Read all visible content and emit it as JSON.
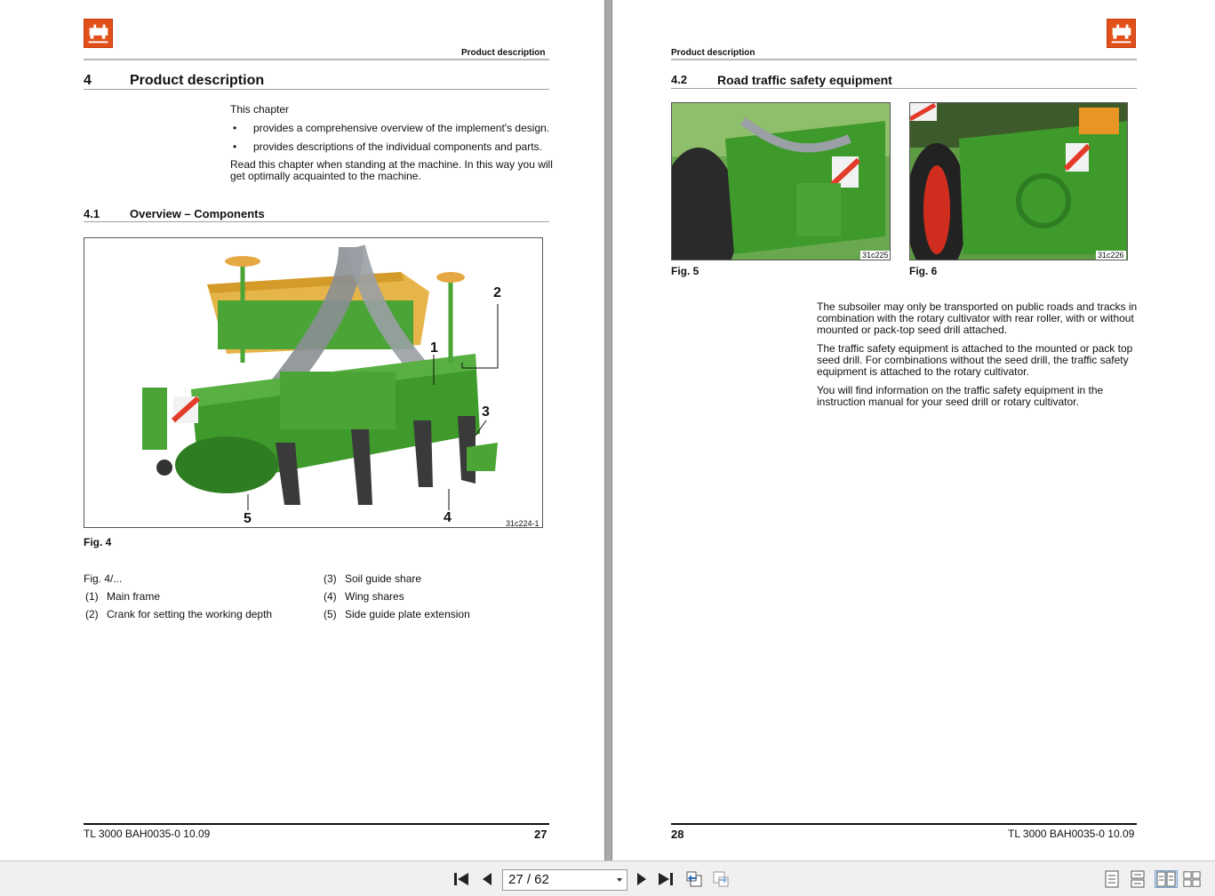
{
  "left_page": {
    "running_header": "Product description",
    "chapter": {
      "number": "4",
      "title": "Product description"
    },
    "intro": "This chapter",
    "bullets": [
      "provides a comprehensive overview of the implement's design.",
      "provides descriptions of the individual components and parts."
    ],
    "read_note_line1": "Read this chapter when standing at the machine. In this way you will",
    "read_note_line2": "get optimally acquainted to the machine.",
    "section": {
      "number": "4.1",
      "title": "Overview – Components"
    },
    "figure": {
      "caption": "Fig. 4",
      "image_code": "31c224-1",
      "callouts": [
        "1",
        "2",
        "3",
        "4",
        "5"
      ]
    },
    "legend": {
      "heading": "Fig. 4/...",
      "items": [
        {
          "num": "(1)",
          "text": "Main frame"
        },
        {
          "num": "(2)",
          "text": "Crank for setting the working depth"
        },
        {
          "num": "(3)",
          "text": "Soil guide share"
        },
        {
          "num": "(4)",
          "text": "Wing shares"
        },
        {
          "num": "(5)",
          "text": "Side guide plate extension"
        }
      ]
    },
    "footer_doc": "TL 3000  BAH0035-0  10.09",
    "page_number": "27"
  },
  "right_page": {
    "running_header": "Product description",
    "section": {
      "number": "4.2",
      "title": "Road traffic safety equipment"
    },
    "fig5": {
      "caption": "Fig. 5",
      "image_code": "31c225"
    },
    "fig6": {
      "caption": "Fig. 6",
      "image_code": "31c226"
    },
    "para1": [
      "The subsoiler may only be transported on public roads and tracks in",
      "combination with the rotary cultivator with rear roller, with or without",
      "mounted or pack-top seed drill attached."
    ],
    "para2": [
      "The traffic safety equipment is attached to the mounted or pack top",
      "seed drill. For combinations without the seed drill, the traffic safety",
      "equipment is attached to the rotary cultivator."
    ],
    "para3": [
      "You will find information on the traffic safety equipment in the",
      "instruction manual for your seed drill or rotary cultivator."
    ],
    "page_number": "28",
    "footer_doc": "TL 3000  BAH0035-0  10.09"
  },
  "toolbar": {
    "page_indicator": "27 / 62",
    "icons": [
      "first-page-icon",
      "previous-page-icon",
      "next-page-icon",
      "last-page-icon",
      "go-back-icon",
      "go-forward-icon",
      "single-page-view-icon",
      "continuous-view-icon",
      "two-page-view-icon",
      "continuous-two-page-view-icon"
    ]
  },
  "colors": {
    "brand_orange": "#e2501a",
    "machine_green": "#3f9a2c",
    "viewer_gutter": "#a9a9a9",
    "toolbar_bg": "#f0f0f0"
  }
}
